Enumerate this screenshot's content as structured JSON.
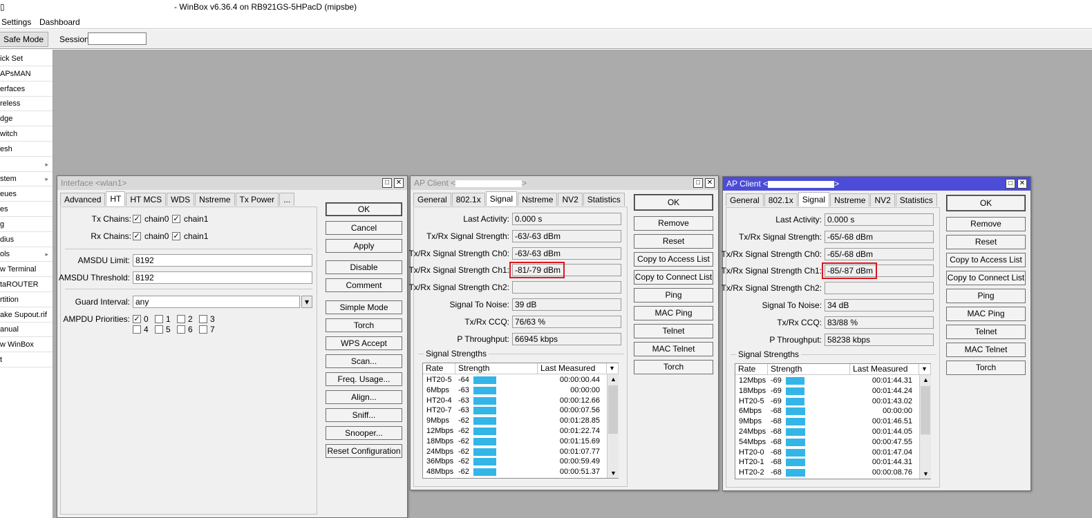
{
  "title": "- WinBox v6.36.4 on RB921GS-5HPacD (mipsbe)",
  "titlebar_edge_glyph": "▯",
  "menu": [
    "Settings",
    "Dashboard"
  ],
  "toolbar": {
    "safe_mode": "Safe Mode",
    "session_label": "Session:",
    "session_value": ""
  },
  "sidebar": [
    "ick Set",
    "APsMAN",
    "erfaces",
    "reless",
    "dge",
    "witch",
    "esh",
    "",
    "stem",
    "eues",
    "es",
    "g",
    "dius",
    "ols",
    "w Terminal",
    "taROUTER",
    "rtition",
    "ake Supout.rif",
    "anual",
    "w WinBox",
    "t"
  ],
  "iface": {
    "title": "Interface <wlan1>",
    "tabs": [
      "Advanced",
      "HT",
      "HT MCS",
      "WDS",
      "Nstreme",
      "Tx Power",
      "..."
    ],
    "tx_chains_label": "Tx Chains:",
    "rx_chains_label": "Rx Chains:",
    "chain0": "chain0",
    "chain1": "chain1",
    "amsdu_limit_label": "AMSDU Limit:",
    "amsdu_limit": "8192",
    "amsdu_threshold_label": "AMSDU Threshold:",
    "amsdu_threshold": "8192",
    "guard_interval_label": "Guard Interval:",
    "guard_interval": "any",
    "ampdu_label": "AMPDU Priorities:",
    "ampdu": [
      "0",
      "1",
      "2",
      "3",
      "4",
      "5",
      "6",
      "7"
    ],
    "buttons": [
      "OK",
      "Cancel",
      "Apply",
      "Disable",
      "Comment",
      "Simple Mode",
      "Torch",
      "WPS Accept",
      "Scan...",
      "Freq. Usage...",
      "Align...",
      "Sniff...",
      "Snooper...",
      "Reset Configuration"
    ]
  },
  "clients": [
    {
      "title": "AP Client <",
      "title_suffix": ">",
      "tabs": [
        "General",
        "802.1x",
        "Signal",
        "Nstreme",
        "NV2",
        "Statistics"
      ],
      "labels": [
        "Last Activity:",
        "Tx/Rx Signal Strength:",
        "Tx/Rx Signal Strength Ch0:",
        "Tx/Rx Signal Strength Ch1:",
        "Tx/Rx Signal Strength Ch2:",
        "Signal To Noise:",
        "Tx/Rx CCQ:",
        "P Throughput:"
      ],
      "values": [
        "0.000 s",
        "-63/-63 dBm",
        "-63/-63 dBm",
        "-81/-79 dBm",
        "",
        "39 dB",
        "76/63 %",
        "66945 kbps"
      ],
      "group": "Signal Strengths",
      "cols": [
        "Rate",
        "Strength",
        "Last Measured"
      ],
      "rows": [
        [
          "HT20-5",
          "-64",
          "00:00:00.44"
        ],
        [
          "6Mbps",
          "-63",
          "00:00:00"
        ],
        [
          "HT20-4",
          "-63",
          "00:00:12.66"
        ],
        [
          "HT20-7",
          "-63",
          "00:00:07.56"
        ],
        [
          "9Mbps",
          "-62",
          "00:01:28.85"
        ],
        [
          "12Mbps",
          "-62",
          "00:01:22.74"
        ],
        [
          "18Mbps",
          "-62",
          "00:01:15.69"
        ],
        [
          "24Mbps",
          "-62",
          "00:01:07.77"
        ],
        [
          "36Mbps",
          "-62",
          "00:00:59.49"
        ],
        [
          "48Mbps",
          "-62",
          "00:00:51.37"
        ]
      ],
      "buttons": [
        "OK",
        "Remove",
        "Reset",
        "Copy to Access List",
        "Copy to Connect List",
        "Ping",
        "MAC Ping",
        "Telnet",
        "MAC Telnet",
        "Torch"
      ]
    },
    {
      "title": "AP Client <",
      "title_suffix": ">",
      "tabs": [
        "General",
        "802.1x",
        "Signal",
        "Nstreme",
        "NV2",
        "Statistics"
      ],
      "labels": [
        "Last Activity:",
        "Tx/Rx Signal Strength:",
        "Tx/Rx Signal Strength Ch0:",
        "Tx/Rx Signal Strength Ch1:",
        "Tx/Rx Signal Strength Ch2:",
        "Signal To Noise:",
        "Tx/Rx CCQ:",
        "P Throughput:"
      ],
      "values": [
        "0.000 s",
        "-65/-68 dBm",
        "-65/-68 dBm",
        "-85/-87 dBm",
        "",
        "34 dB",
        "83/88 %",
        "58238 kbps"
      ],
      "group": "Signal Strengths",
      "cols": [
        "Rate",
        "Strength",
        "Last Measured"
      ],
      "rows": [
        [
          "12Mbps",
          "-69",
          "00:01:44.31"
        ],
        [
          "18Mbps",
          "-69",
          "00:01:44.24"
        ],
        [
          "HT20-5",
          "-69",
          "00:01:43.02"
        ],
        [
          "6Mbps",
          "-68",
          "00:00:00"
        ],
        [
          "9Mbps",
          "-68",
          "00:01:46.51"
        ],
        [
          "24Mbps",
          "-68",
          "00:01:44.05"
        ],
        [
          "54Mbps",
          "-68",
          "00:00:47.55"
        ],
        [
          "HT20-0",
          "-68",
          "00:01:47.04"
        ],
        [
          "HT20-1",
          "-68",
          "00:01:44.31"
        ],
        [
          "HT20-2",
          "-68",
          "00:00:08.76"
        ]
      ],
      "buttons": [
        "OK",
        "Remove",
        "Reset",
        "Copy to Access List",
        "Copy to Connect List",
        "Ping",
        "MAC Ping",
        "Telnet",
        "MAC Telnet",
        "Torch"
      ]
    }
  ]
}
